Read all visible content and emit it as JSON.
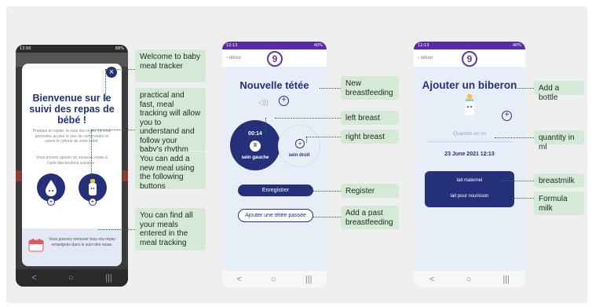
{
  "phone1": {
    "status_time": "13:50",
    "status_right": "68%",
    "close_label": "×",
    "title": "Bienvenue sur le suivi des repas de bébé !",
    "para1": "Pratique et rapide, le suivi des repas va vous permettre au jour le jour de comprendre et suivre le rythme de votre bébé.",
    "para2": "Vous pouvez ajouter un nouveau repas à l'aide des boutons suivants :",
    "footer_text": "Vous pourrez retrouver tous vos repas renseignés dans le suivi des repas."
  },
  "phone2": {
    "status_time": "12:13",
    "status_right": "40%",
    "back_label": "retour",
    "logo_glyph": "9",
    "title": "Nouvelle tétée",
    "timer": "00:14",
    "left_label": "sein gauche",
    "right_label": "sein droit",
    "register_label": "Enregistrer",
    "past_label": "Ajouter une tétée passée"
  },
  "phone3": {
    "status_time": "12:13",
    "status_right": "40%",
    "back_label": "retour",
    "logo_glyph": "9",
    "title": "Ajouter un biberon",
    "quantity_placeholder": "Quantité en ml",
    "date_text": "23 June 2021 12:13",
    "breastmilk_label": "lait maternel",
    "formula_label": "lait pour nourisson"
  },
  "callouts": {
    "welcome": "Welcome to baby meal tracker",
    "practical": "practical and fast, meal tracking will allow you to understand and follow your baby's rhythm day by day.",
    "add_meal": "You can add a new meal using the following buttons",
    "find_meals": "You can find all your meals entered in the meal tracking",
    "new_breastfeeding": "New breastfeeding",
    "left_breast": "left breast",
    "right_breast": "right breast",
    "register": "Register",
    "add_past": "Add a past breastfeeding",
    "add_bottle": "Add a bottle",
    "quantity": "quantity in ml",
    "breastmilk": "breastmilk",
    "formula": "Formula milk"
  },
  "nav": {
    "back": "<",
    "home": "○",
    "recent": "|||"
  },
  "colors": {
    "navy": "#24317a",
    "callout_bg": "#d4ead7",
    "purple": "#5d2aa5"
  }
}
